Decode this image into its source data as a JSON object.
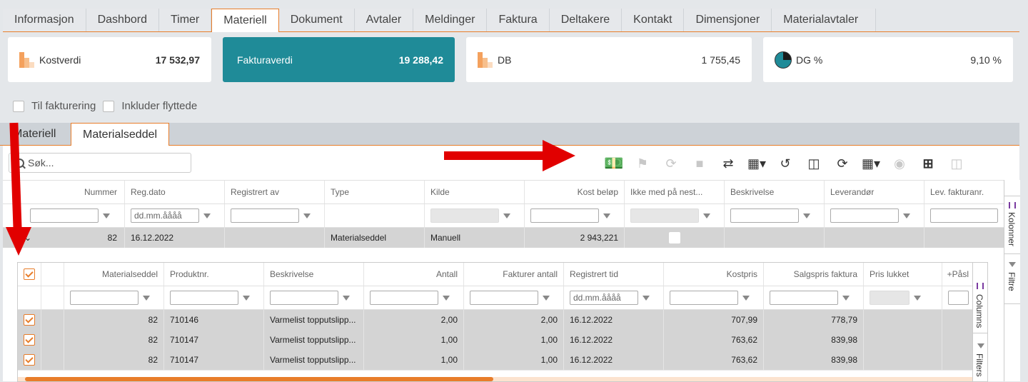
{
  "tabs": [
    "Informasjon",
    "Dashbord",
    "Timer",
    "Materiell",
    "Dokument",
    "Avtaler",
    "Meldinger",
    "Faktura",
    "Deltakere",
    "Kontakt",
    "Dimensjoner",
    "Materialavtaler"
  ],
  "cards": {
    "kostverdi": {
      "label": "Kostverdi",
      "value": "17 532,97"
    },
    "fakturaverdi": {
      "label": "Fakturaverdi",
      "value": "19 288,42"
    },
    "db": {
      "label": "DB",
      "value": "1 755,45"
    },
    "dg": {
      "label": "DG %",
      "value": "9,10 %"
    }
  },
  "checks": {
    "til_fakturering": "Til fakturering",
    "inkluder": "Inkluder flyttede"
  },
  "subtabs": {
    "materiell": "Materiell",
    "materialseddel": "Materialseddel"
  },
  "search": {
    "placeholder": "Søk..."
  },
  "outer": {
    "headers": [
      "Nummer",
      "Reg.dato",
      "Registrert av",
      "Type",
      "Kilde",
      "Kost beløp",
      "Ikke med på nest...",
      "Beskrivelse",
      "Leverandør",
      "Lev. fakturanr."
    ],
    "date_placeholder": "dd.mm.åååå",
    "row": {
      "nummer": "82",
      "regdato": "16.12.2022",
      "type": "Materialseddel",
      "kilde": "Manuell",
      "kost": "2 943,221"
    },
    "side_label": "Kolonner",
    "side_filter": "Filtre"
  },
  "inner": {
    "headers": [
      "Materialseddel",
      "Produktnr.",
      "Beskrivelse",
      "Antall",
      "Fakturer antall",
      "Registrert tid",
      "Kostpris",
      "Salgspris faktura",
      "Pris lukket",
      "+Påsl"
    ],
    "date_placeholder": "dd.mm.åååå",
    "rows": [
      {
        "ms": "82",
        "prod": "710146",
        "besk": "Varmelist topputslipp...",
        "antall": "2,00",
        "fakt": "2,00",
        "tid": "16.12.2022",
        "kost": "707,99",
        "salg": "778,79"
      },
      {
        "ms": "82",
        "prod": "710147",
        "besk": "Varmelist topputslipp...",
        "antall": "1,00",
        "fakt": "1,00",
        "tid": "16.12.2022",
        "kost": "763,62",
        "salg": "839,98"
      },
      {
        "ms": "82",
        "prod": "710147",
        "besk": "Varmelist topputslipp...",
        "antall": "1,00",
        "fakt": "1,00",
        "tid": "16.12.2022",
        "kost": "763,62",
        "salg": "839,98"
      }
    ],
    "side_label": "Columns",
    "side_filter": "Filters"
  },
  "colors": {
    "accent": "#e87d2a",
    "teal": "#1f8b98",
    "arrow": "#e10000"
  }
}
